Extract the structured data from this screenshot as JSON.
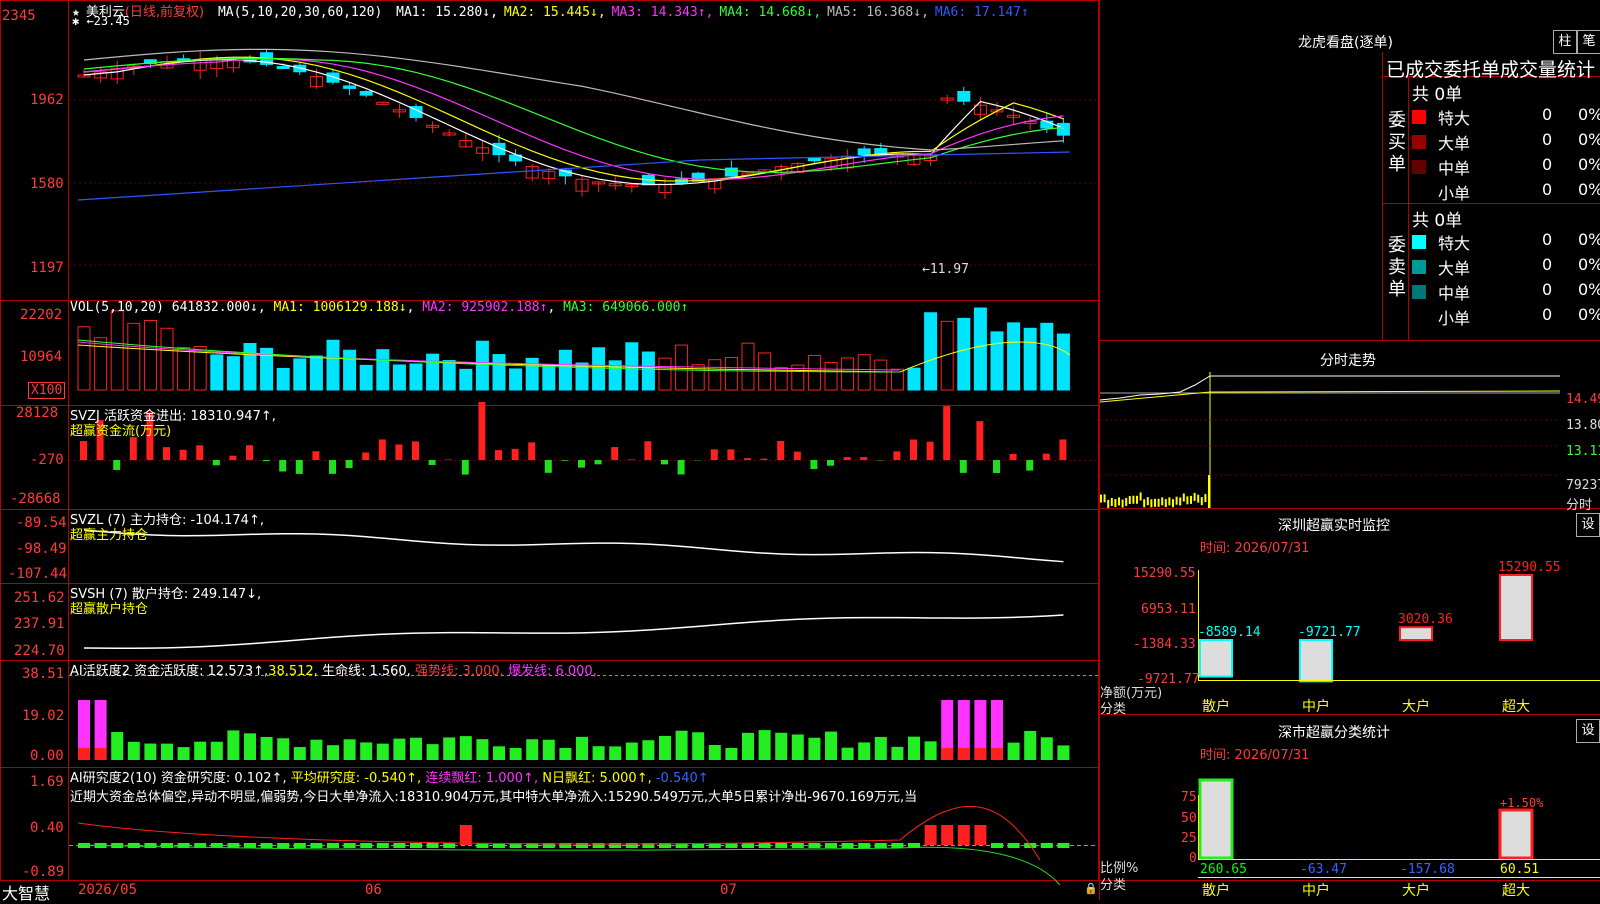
{
  "stock": {
    "name": "美利云",
    "period": "(日线,前复权)",
    "ma_prefix": "MA(5,10,20,30,60,120)",
    "ma_values": [
      {
        "label": "MA1: 15.280↓",
        "color": "#ffffff"
      },
      {
        "label": "MA2: 15.445↓",
        "color": "#ffff00"
      },
      {
        "label": "MA3: 14.343↑",
        "color": "#ff33ff"
      },
      {
        "label": "MA4: 14.668↓",
        "color": "#33ff33"
      },
      {
        "label": "MA5: 16.368↓",
        "color": "#bbbbbb"
      },
      {
        "label": "MA6: 17.147↑",
        "color": "#3355ff"
      }
    ],
    "high_marker": "←23.45",
    "low_marker": "←11.97"
  },
  "colors": {
    "up": "#ff2020",
    "down": "#00e5ff",
    "grid": "#8b0000",
    "axis": "#ff3b3b"
  },
  "price_axis": [
    "2345",
    "1962",
    "1580",
    "1197"
  ],
  "vol": {
    "title": "VOL(5,10,20)",
    "value": "641832.000↓",
    "ma1": "MA1: 1006129.188↓",
    "ma2": "MA2: 925902.188↑",
    "ma3": "MA3: 649066.000↑",
    "axis": [
      "22202",
      "10964"
    ],
    "unit": "X100"
  },
  "svzj": {
    "title": "SVZJ",
    "label": "活跃资金进出: 18310.947↑,",
    "sub": "超赢资金流(万元)",
    "axis": [
      "28128",
      "-270",
      "-28668"
    ]
  },
  "svzl": {
    "title": "SVZL",
    "label": "(7) 主力持仓: -104.174↑,",
    "sub": "超赢主力持仓",
    "axis": [
      "-89.54",
      "-98.49",
      "-107.44"
    ]
  },
  "svsh": {
    "title": "SVSH",
    "label": "(7) 散户持仓: 249.147↓,",
    "sub": "超赢散户持仓",
    "axis": [
      "251.62",
      "237.91",
      "224.70"
    ]
  },
  "ai_active": {
    "title": "AI活跃度2",
    "p1": "资金活跃度: 12.573↑,",
    "p2": "38.512,",
    "p3": "生命线: 1.560,",
    "p4": "强势线: 3.000,",
    "p5": "爆发线: 6.000,",
    "axis": [
      "38.51",
      "19.02",
      "0.00"
    ]
  },
  "ai_research": {
    "title": "AI研究度2(10)",
    "p1": "资金研究度: 0.102↑,",
    "p2": "平均研究度: -0.540↑,",
    "p3": "连续飘红: 1.000↑,",
    "p4": "N日飘红: 5.000↑,",
    "p5": "-0.540↑",
    "summary": "近期大资金总体偏空,异动不明显,偏弱势,今日大单净流入:18310.904万元,其中特大单净流入:15290.549万元,大单5日累计净出-9670.169万元,当",
    "axis": [
      "1.69",
      "0.40",
      "-0.89"
    ]
  },
  "date_axis": [
    "2026/05",
    "06",
    "07"
  ],
  "brand": "大智慧",
  "lhb": {
    "title": "龙虎看盘(逐单)",
    "btn1": "柱",
    "btn2": "笔",
    "tabs": "已成交委托单成交量统计",
    "buy_label": "委买单",
    "sell_label": "委卖单",
    "buy_total": "共 0单",
    "sell_total": "共 0单",
    "buy_rows": [
      {
        "name": "特大",
        "count": "0",
        "pct": "0%",
        "color": "#ff0000"
      },
      {
        "name": "大单",
        "count": "0",
        "pct": "0%",
        "color": "#990000"
      },
      {
        "name": "中单",
        "count": "0",
        "pct": "0%",
        "color": "#660000"
      },
      {
        "name": "小单",
        "count": "0",
        "pct": "0%",
        "color": "#000000"
      }
    ],
    "sell_rows": [
      {
        "name": "特大",
        "count": "0",
        "pct": "0%",
        "color": "#00ffff"
      },
      {
        "name": "大单",
        "count": "0",
        "pct": "0%",
        "color": "#009999"
      },
      {
        "name": "中单",
        "count": "0",
        "pct": "0%",
        "color": "#007777"
      },
      {
        "name": "小单",
        "count": "0",
        "pct": "0%",
        "color": "#000000"
      }
    ]
  },
  "intraday": {
    "title": "分时走势",
    "axis": [
      "14.49",
      "13.80",
      "13.11"
    ],
    "vol": "79237",
    "unit": "分时"
  },
  "sz_monitor": {
    "title": "深圳超赢实时监控",
    "set": "设",
    "time": "时间: 2026/07/31",
    "axis": [
      "15290.55",
      "6953.11",
      "-1384.33",
      "-9721.77"
    ],
    "ylabel": "净额(万元)",
    "xlabel": "分类",
    "bars": [
      {
        "cat": "散户",
        "value": -8589.14,
        "label": "-8589.14"
      },
      {
        "cat": "中户",
        "value": -9721.77,
        "label": "-9721.77"
      },
      {
        "cat": "大户",
        "value": 3020.36,
        "label": "3020.36"
      },
      {
        "cat": "超大",
        "value": 15290.55,
        "label": "15290.55"
      }
    ]
  },
  "sz_class": {
    "title": "深市超赢分类统计",
    "set": "设",
    "time": "时间: 2026/07/31",
    "axis": [
      "75",
      "50",
      "25",
      "0"
    ],
    "ylabel": "比例%",
    "xlabel": "分类",
    "pct_label": "+1.50%",
    "bars": [
      {
        "cat": "散户",
        "label": "260.65",
        "color": "#00ff00"
      },
      {
        "cat": "中户",
        "label": "-63.47",
        "color": "#3366ff"
      },
      {
        "cat": "大户",
        "label": "-157.68",
        "color": "#3366ff"
      },
      {
        "cat": "超大",
        "label": "60.51",
        "color": "#ffff00"
      }
    ]
  }
}
